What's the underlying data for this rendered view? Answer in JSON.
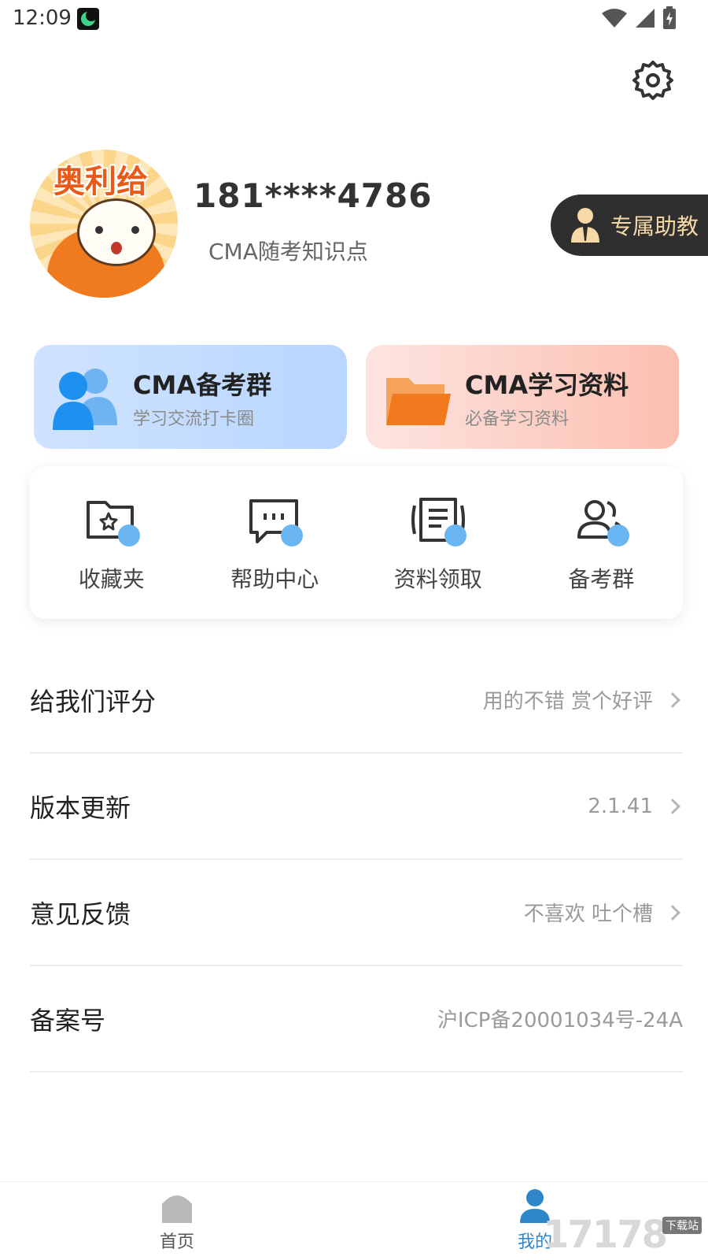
{
  "status_bar": {
    "time": "12:09"
  },
  "profile": {
    "avatar_text": "奥利给",
    "phone": "181****4786",
    "subject": "CMA随考知识点",
    "assistant_label": "专属助教"
  },
  "promo_cards": [
    {
      "title": "CMA备考群",
      "subtitle": "学习交流打卡圈"
    },
    {
      "title": "CMA学习资料",
      "subtitle": "必备学习资料"
    }
  ],
  "quick_actions": [
    {
      "label": "收藏夹",
      "icon": "favorites-folder-icon"
    },
    {
      "label": "帮助中心",
      "icon": "help-chat-icon"
    },
    {
      "label": "资料领取",
      "icon": "document-icon"
    },
    {
      "label": "备考群",
      "icon": "group-icon"
    }
  ],
  "menu": [
    {
      "label": "给我们评分",
      "value": "用的不错 赏个好评"
    },
    {
      "label": "版本更新",
      "value": "2.1.41"
    },
    {
      "label": "意见反馈",
      "value": "不喜欢 吐个槽"
    },
    {
      "label": "备案号",
      "value": "沪ICP备20001034号-24A"
    }
  ],
  "bottom_nav": {
    "home": "首页",
    "mine": "我的"
  },
  "watermark": {
    "text": "17178",
    "tag": "下载站"
  },
  "colors": {
    "accent_blue": "#2e86c9",
    "assistant_text": "#f6d9a6",
    "promo_blue": "#b8d6ff",
    "promo_pink": "#fbbfb0"
  }
}
